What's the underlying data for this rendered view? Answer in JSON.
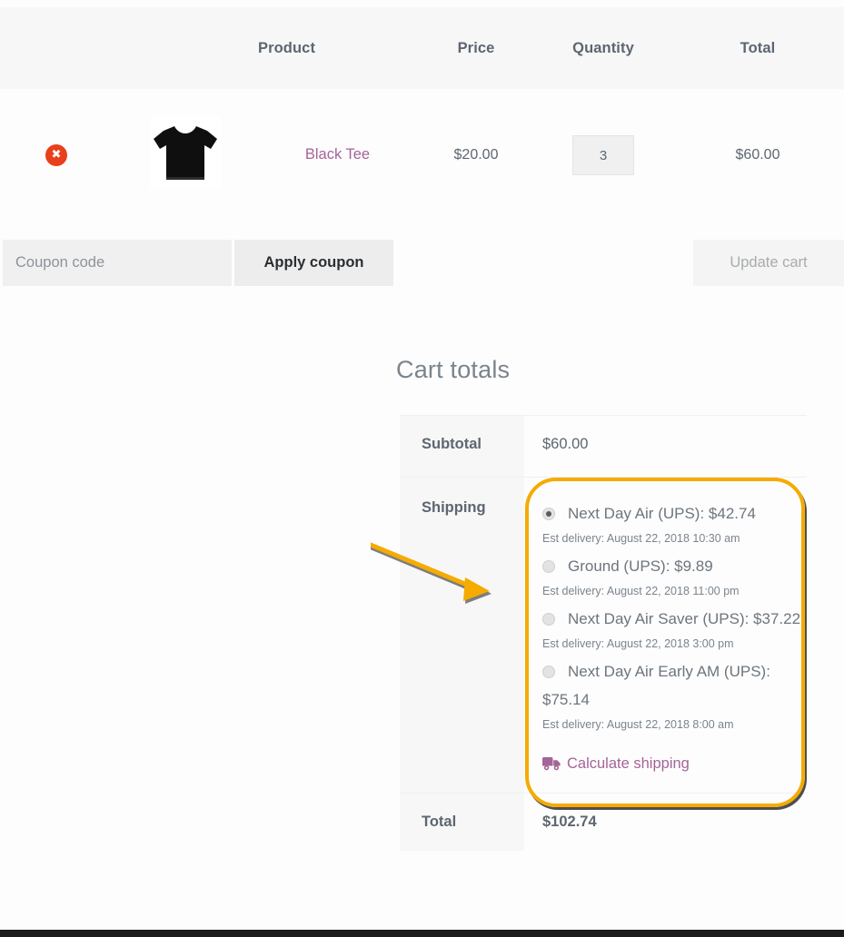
{
  "cart_table": {
    "headers": [
      "",
      "",
      "Product",
      "Price",
      "Quantity",
      "Total"
    ],
    "rows": [
      {
        "remove_icon": "remove-x-icon",
        "thumbnail": "black-tee-thumbnail",
        "product": "Black Tee",
        "price": "$20.00",
        "quantity": "3",
        "total": "$60.00"
      }
    ]
  },
  "coupon": {
    "placeholder": "Coupon code",
    "value": "",
    "apply_label": "Apply coupon",
    "update_label": "Update cart"
  },
  "cart_totals": {
    "heading": "Cart totals",
    "subtotal_label": "Subtotal",
    "subtotal_value": "$60.00",
    "shipping_label": "Shipping",
    "shipping_options": [
      {
        "label": "Next Day Air (UPS): $42.74",
        "eta": "Est delivery: August 22, 2018 10:30 am",
        "selected": true
      },
      {
        "label": "Ground (UPS): $9.89",
        "eta": "Est delivery: August 22, 2018 11:00 pm",
        "selected": false
      },
      {
        "label": "Next Day Air Saver (UPS): $37.22",
        "eta": "Est delivery: August 22, 2018 3:00 pm",
        "selected": false
      },
      {
        "label": "Next Day Air Early AM (UPS): $75.14",
        "eta": "Est delivery: August 22, 2018 8:00 am",
        "selected": false
      }
    ],
    "calculate_shipping_label": "Calculate shipping",
    "calculate_shipping_icon": "truck-icon",
    "total_label": "Total",
    "total_value": "$102.74"
  },
  "annotations": {
    "highlight_color": "#f5ab00",
    "arrow_color": "#f5ab00"
  },
  "colors": {
    "link": "#a46497",
    "remove": "#e8401c",
    "text": "#5d6671",
    "header_bg": "#f7f7f7"
  }
}
